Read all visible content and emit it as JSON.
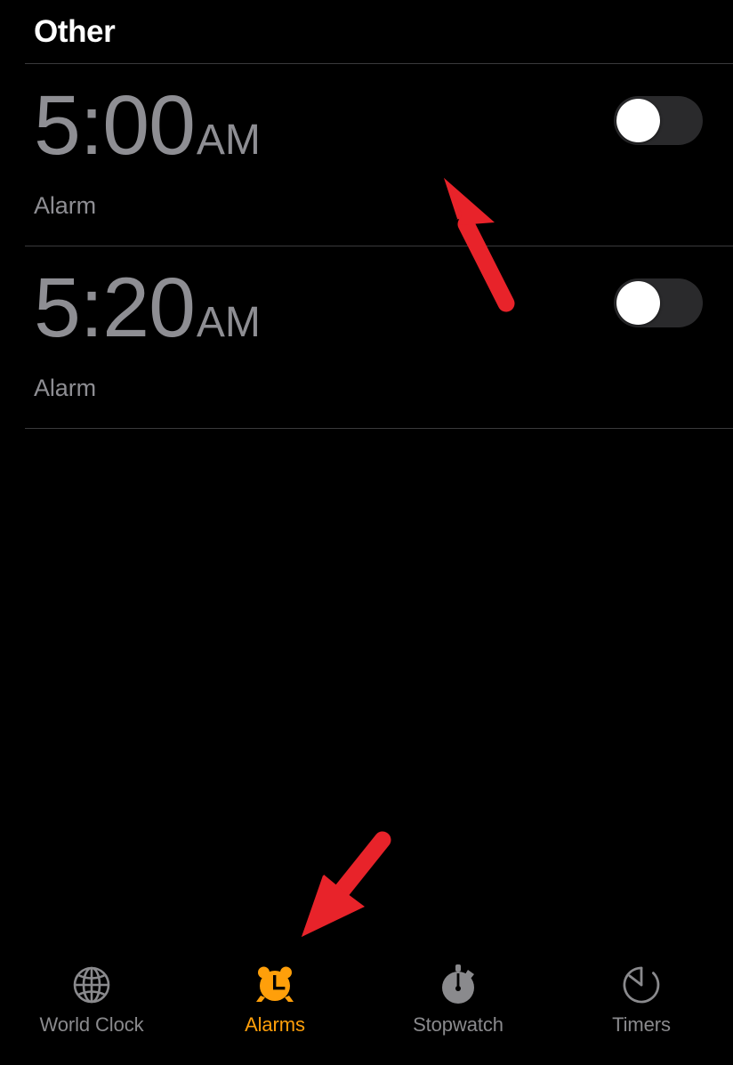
{
  "screen": {
    "app": "Clock",
    "background_color": "#000000",
    "accent_color": "#ff9f0a",
    "muted_color": "#8e8e93"
  },
  "header": {
    "title": "Other"
  },
  "alarms": [
    {
      "time": "5:00",
      "meridiem": "AM",
      "label": "Alarm",
      "enabled": false,
      "toggle_state": "off"
    },
    {
      "time": "5:20",
      "meridiem": "AM",
      "label": "Alarm",
      "enabled": false,
      "toggle_state": "off"
    }
  ],
  "tabbar": {
    "active_tab": "Alarms",
    "tabs": [
      {
        "label": "World Clock",
        "icon": "globe-icon",
        "active": false
      },
      {
        "label": "Alarms",
        "icon": "alarm-clock-icon",
        "active": true
      },
      {
        "label": "Stopwatch",
        "icon": "stopwatch-icon",
        "active": false
      },
      {
        "label": "Timers",
        "icon": "timer-icon",
        "active": false
      }
    ]
  },
  "annotations": {
    "color": "#e8232a",
    "arrows": [
      {
        "name": "arrow-pointing-to-first-alarm-toggle",
        "direction": "up-left"
      },
      {
        "name": "arrow-pointing-to-alarms-tab",
        "direction": "down-left"
      }
    ]
  }
}
